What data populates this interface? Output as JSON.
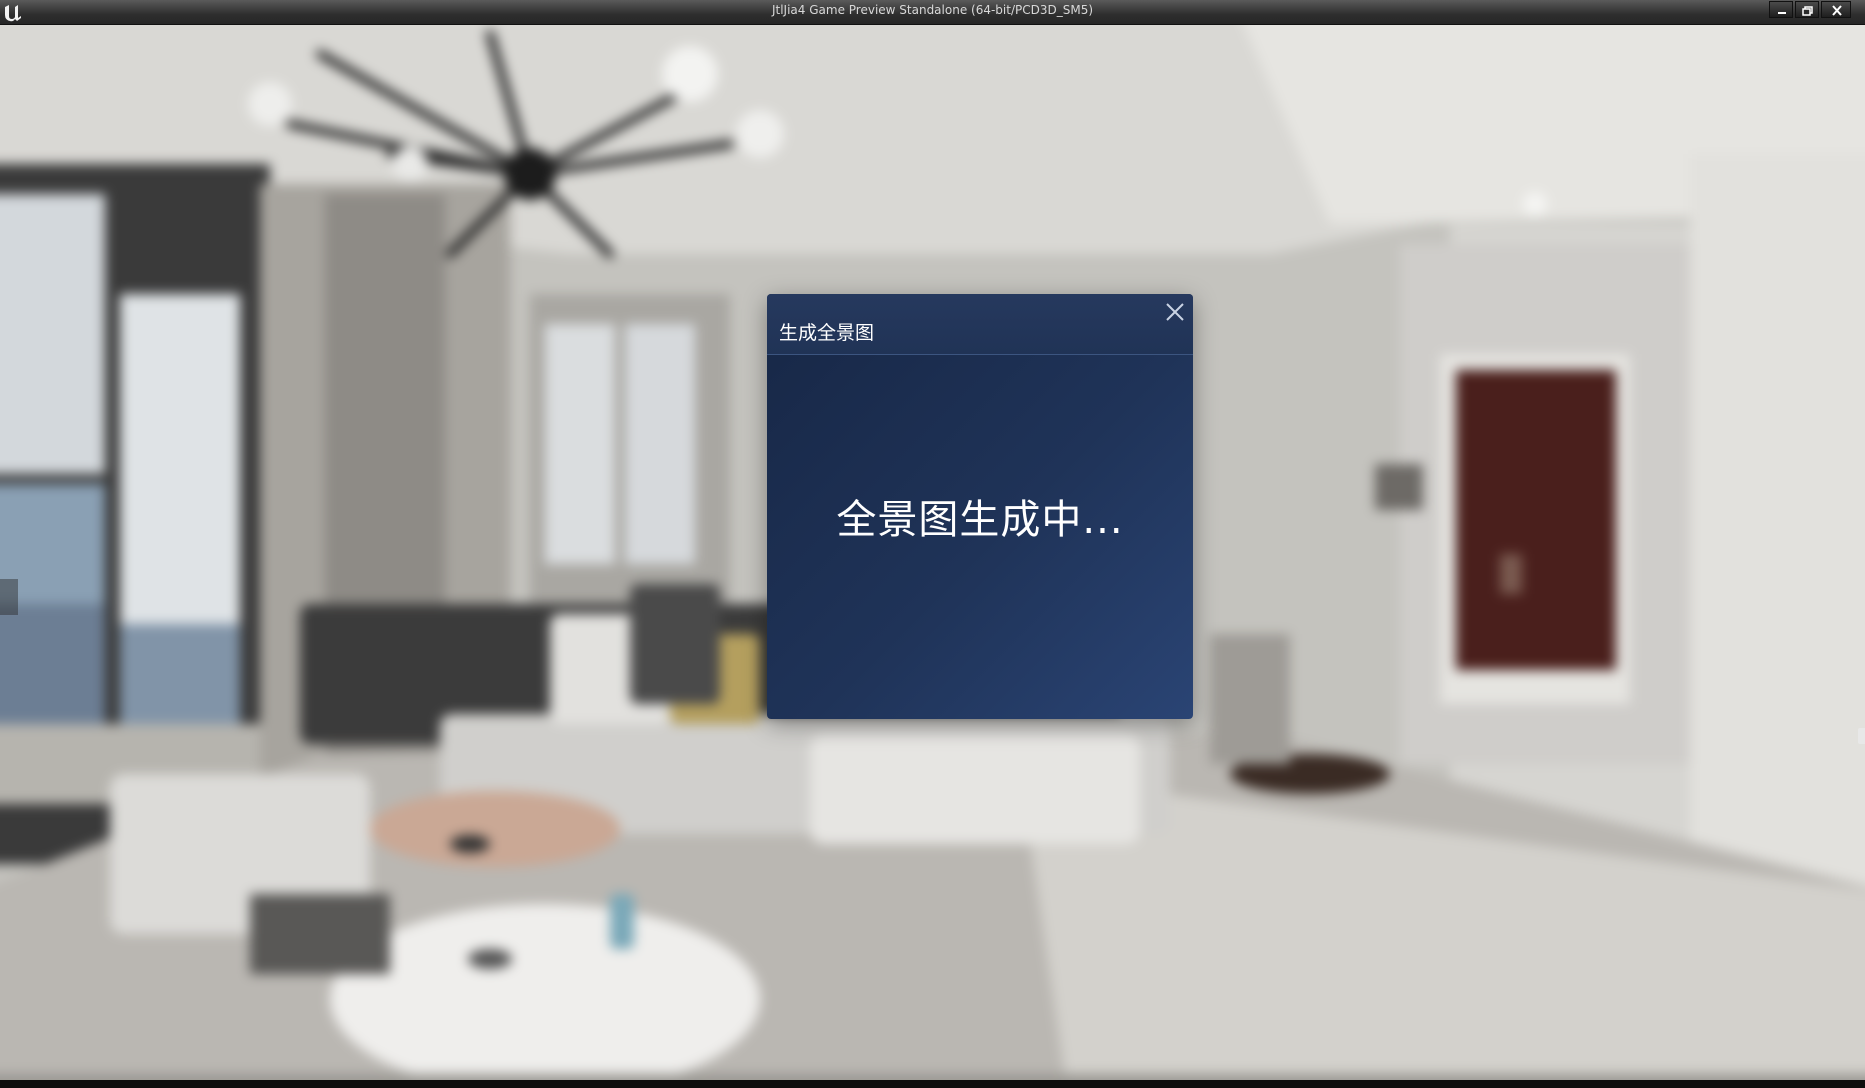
{
  "window": {
    "title": "JtlJia4 Game Preview Standalone (64-bit/PCD3D_SM5)",
    "logo_icon": "unreal-engine-logo",
    "controls": [
      "minimize-icon",
      "restore-icon",
      "close-icon"
    ]
  },
  "dialog": {
    "title": "生成全景图",
    "message": "全景图生成中...",
    "close_icon": "close-icon"
  },
  "colors": {
    "dialog_top": "#172746",
    "dialog_bottom": "#2a4474",
    "title_bar": "#2e2e2e",
    "text": "#ffffff"
  }
}
